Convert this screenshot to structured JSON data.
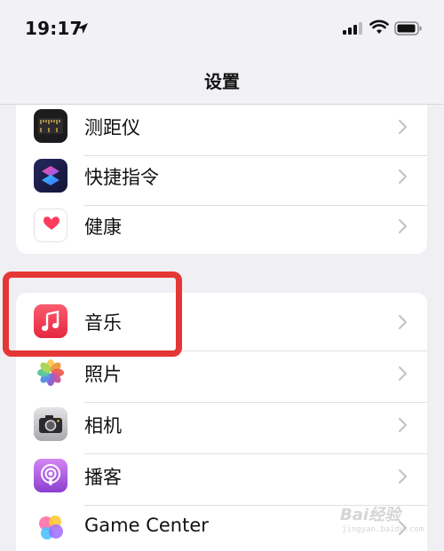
{
  "status_bar": {
    "time": "19:17"
  },
  "nav": {
    "title": "设置"
  },
  "groups": [
    {
      "items": [
        {
          "label": "测距仪",
          "icon": "measure-icon"
        },
        {
          "label": "快捷指令",
          "icon": "shortcuts-icon"
        },
        {
          "label": "健康",
          "icon": "health-icon"
        }
      ]
    },
    {
      "items": [
        {
          "label": "音乐",
          "icon": "music-icon",
          "highlighted": true
        },
        {
          "label": "照片",
          "icon": "photos-icon"
        },
        {
          "label": "相机",
          "icon": "camera-icon"
        },
        {
          "label": "播客",
          "icon": "podcasts-icon"
        },
        {
          "label": "Game Center",
          "icon": "game-center-icon"
        }
      ]
    }
  ],
  "annotation": {
    "highlight_color": "#e53636"
  },
  "watermark": {
    "main": "Bai经验",
    "sub": "jingyan.baidu.com"
  }
}
